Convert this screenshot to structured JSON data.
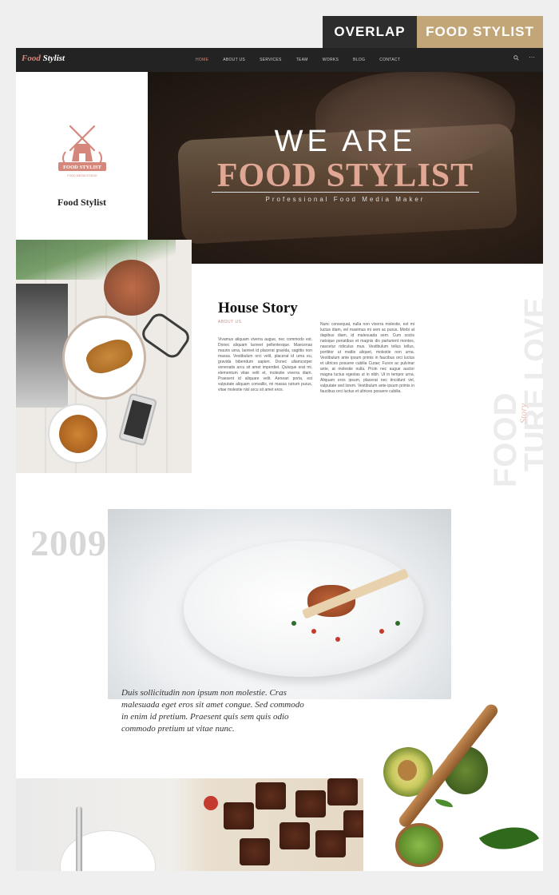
{
  "ribbon": {
    "left": "OVERLAP",
    "right": "FOOD STYLIST"
  },
  "nav": {
    "logo_accent": "Food",
    "logo_rest": " Stylist",
    "items": [
      "HOME",
      "ABOUT US",
      "SERVICES",
      "TEAM",
      "WORKS",
      "BLOG",
      "CONTACT"
    ]
  },
  "brand": {
    "name": "Food Stylist",
    "emblem_text": "FOOD STYLIST",
    "emblem_small": "FOOD MEDIA STUDIO"
  },
  "hero": {
    "line1": "WE ARE",
    "line2": "FOOD STYLIST",
    "tagline": "Professional Food Media Maker"
  },
  "story": {
    "title": "House Story",
    "subtitle": "ABOUT US",
    "col1": "Vivamus aliquam viverra augue, nec commodo est. Donec aliquam laoreet pellentesque. Maecenas mauris urna, laoreet id placerat gravida, sagittis non massa. Vestibulum orci velit, placerat id urna eu, gravida bibendum sapien. Donec ullamcorper venenatis arcu sit amet imperdiet. Quisque erat mi, elementum vitae velit et, molestie viverra diam. Praesent id aliquare velit. Aenean porta, est vulputate aliquam convallis, mi massa rutrum purus, vitae molestie nisl arcu sit amet eros.",
    "col2": "Nunc consequat, nulla non viverra molestie, est mi luctus diam, vel maximus mi sem ac purus. Morbi at dapibus diam, id malesuada sem. Cum sociis natoque penatibus et magnis dis parturient montes, nascetur ridiculus mus. Vestibulum tellus tellus, porttitor ut mattis aliquet, molestie non urna. Vestibulum ante ipsum primis in faucibus orci luctus et ultrices posuere cubilia Curae; Fusce ac pulvinar ante, at molestie nulla. Proin nec augue auctor magna luctus egestas ut in nibh. Ut in tempor urna. Aliquam eros ipsum, placerat nec tincidunt vel, vulputate sed lorem. Vestibulum ante ipsum primis in faucibus orci luctus et ultrices posuere cubilia.",
    "vertical_main": "FOOD",
    "vertical_second": "TURE LOVE",
    "vertical_script": "Story"
  },
  "feature": {
    "year": "2009",
    "caption": "Duis sollicitudin non ipsum non molestie. Cras malesuada eget eros sit amet congue. Sed commodo in enim id pretium. Praesent quis sem quis odio commodo pretium ut vitae nunc."
  },
  "colors": {
    "accent": "#d4877a",
    "gold": "#c3a677",
    "dark": "#232323"
  },
  "icons": {
    "search": "search-icon",
    "more": "more-icon"
  }
}
